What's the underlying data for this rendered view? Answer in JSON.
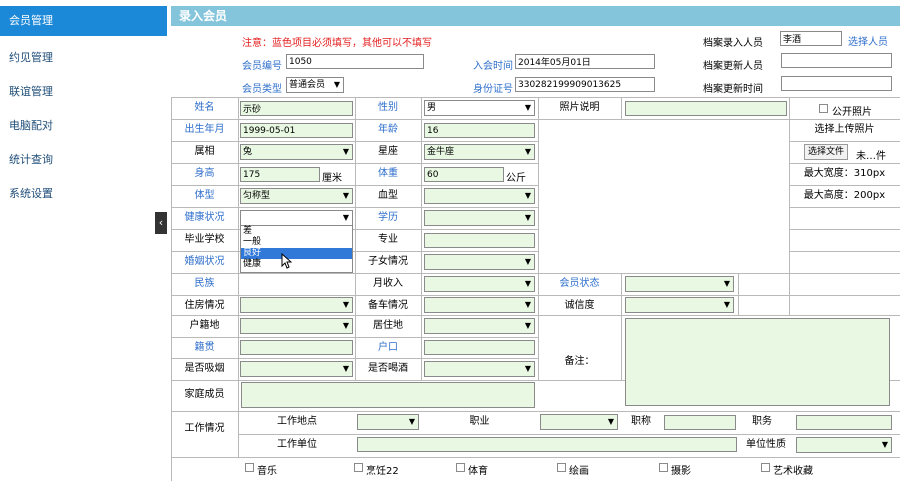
{
  "sidebar": {
    "items": [
      {
        "label": "会员管理"
      },
      {
        "label": "约见管理"
      },
      {
        "label": "联谊管理"
      },
      {
        "label": "电脑配对"
      },
      {
        "label": "统计查询"
      },
      {
        "label": "系统设置"
      }
    ],
    "collapse_glyph": "‹"
  },
  "title": "录入会员",
  "header": {
    "notice": "注意：蓝色项目必须填写，其他可以不填写",
    "member_no_label": "会员编号",
    "member_no": "1050",
    "join_time_label": "入会时间",
    "join_time": "2014年05月01日",
    "member_type_label": "会员类型",
    "member_type": "普通会员",
    "id_card_label": "身份证号",
    "id_card": "330282199909013625",
    "entry_person_label": "档案录入人员",
    "entry_person": "李酒",
    "select_person": "选择人员",
    "update_person_label": "档案更新人员",
    "update_time_label": "档案更新时间"
  },
  "form": {
    "name_label": "姓名",
    "name": "示砂",
    "gender_label": "性别",
    "gender": "男",
    "photo_label": "照片说明",
    "public_photo": "公开照片",
    "birth_label": "出生年月",
    "birth": "1999-05-01",
    "age_label": "年龄",
    "age": "16",
    "upload_label": "选择上传照片",
    "zodiac_label": "属相",
    "zodiac": "兔",
    "constellation_label": "星座",
    "constellation": "金牛座",
    "choose_file": "选择文件",
    "no_file": "未…件",
    "height_label": "身高",
    "height": "175",
    "height_unit": "厘米",
    "weight_label": "体重",
    "weight": "60",
    "weight_unit": "公斤",
    "max_width": "最大宽度：310px",
    "body_label": "体型",
    "body": "匀称型",
    "blood_label": "血型",
    "max_height": "最大高度：200px",
    "health_label": "健康状况",
    "edu_label": "学历",
    "school_label": "毕业学校",
    "major_label": "专业",
    "marriage_label": "婚姻状况",
    "children_label": "子女情况",
    "ethnic_label": "民族",
    "income_label": "月收入",
    "status_label": "会员状态",
    "housing_label": "住房情况",
    "car_label": "备车情况",
    "credit_label": "诚信度",
    "hukou_label": "户籍地",
    "residence_label": "居住地",
    "native_label": "籍贯",
    "household_label": "户口",
    "smoke_label": "是否吸烟",
    "drink_label": "是否喝酒",
    "remark_label": "备注：",
    "family_label": "家庭成员",
    "work_label": "工作情况",
    "work_place_label": "工作地点",
    "job_label": "职业",
    "title_label": "职称",
    "duty_label": "职务",
    "work_unit_label": "工作单位",
    "unit_nature_label": "单位性质"
  },
  "health_dropdown": [
    "差",
    "一般",
    "良好",
    "健康"
  ],
  "health_dropdown_highlight": "良好",
  "hobbies": [
    "音乐",
    "烹饪22",
    "体育",
    "绘画",
    "摄影",
    "艺术收藏"
  ]
}
